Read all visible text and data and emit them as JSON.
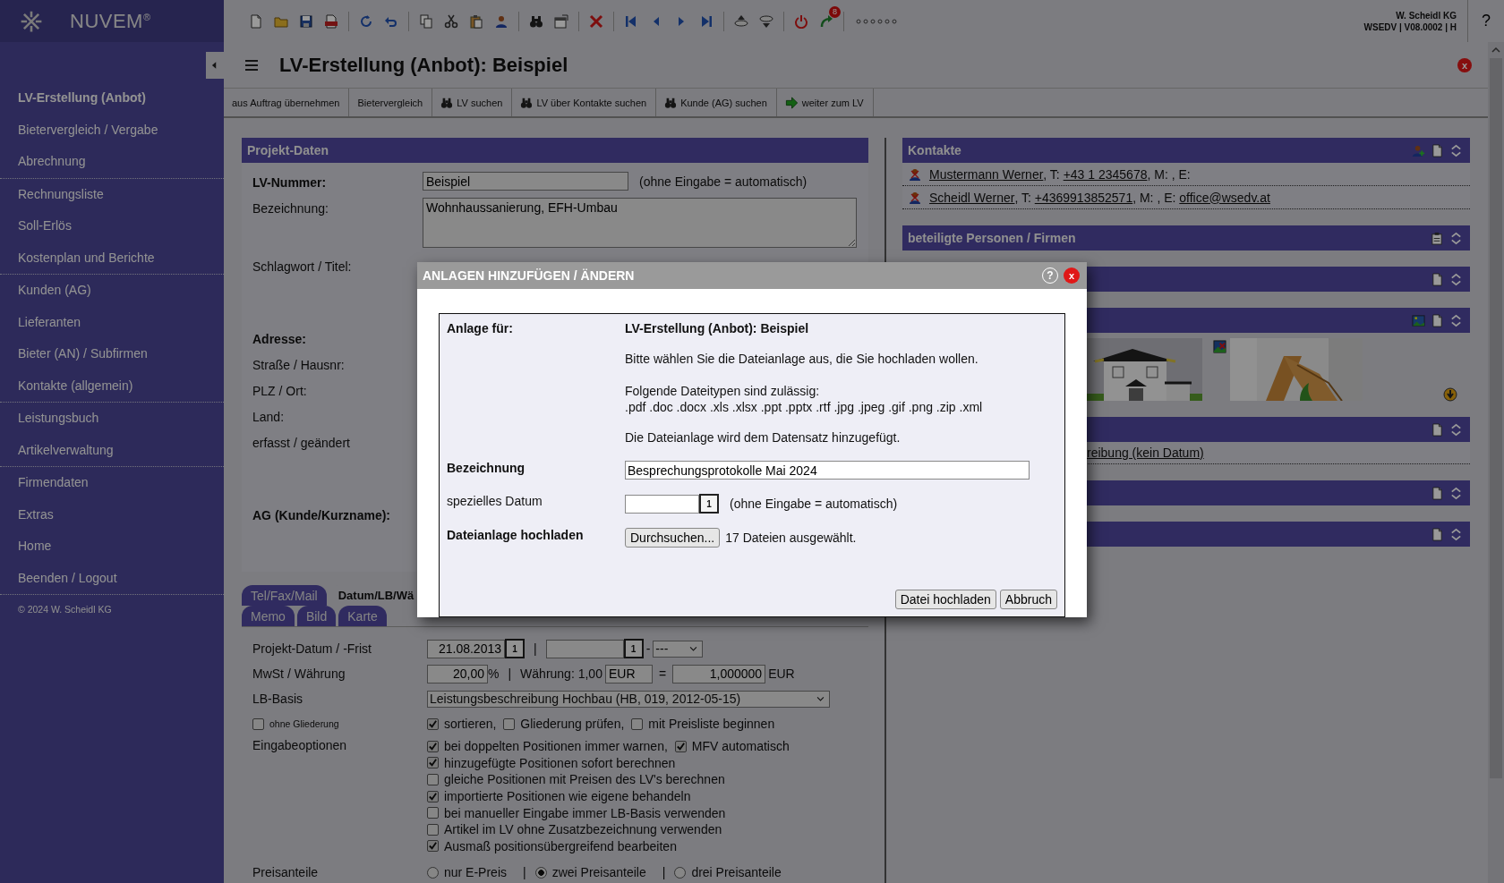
{
  "header": {
    "logo": "NUVEM$^{®}$",
    "badge": "8",
    "company": "W. Scheidl KG",
    "version": "WSEDV | V08.0002 | H",
    "help": "?"
  },
  "sidebar": {
    "groups": [
      [
        {
          "label": "LV-Erstellung (Anbot)",
          "selected": true
        },
        {
          "label": "Bietervergleich / Vergabe",
          "selected": false
        },
        {
          "label": "Abrechnung",
          "selected": false
        }
      ],
      [
        {
          "label": "Rechnungsliste",
          "selected": false
        },
        {
          "label": "Soll-Erlös",
          "selected": false
        },
        {
          "label": "Kostenplan und Berichte",
          "selected": false
        }
      ],
      [
        {
          "label": "Kunden (AG)",
          "selected": false
        },
        {
          "label": "Lieferanten",
          "selected": false
        },
        {
          "label": "Bieter (AN) / Subfirmen",
          "selected": false
        },
        {
          "label": "Kontakte (allgemein)",
          "selected": false
        }
      ],
      [
        {
          "label": "Leistungsbuch",
          "selected": false
        },
        {
          "label": "Artikelverwaltung",
          "selected": false
        }
      ],
      [
        {
          "label": "Firmendaten",
          "selected": false
        },
        {
          "label": "Extras",
          "selected": false
        },
        {
          "label": "Home",
          "selected": false
        },
        {
          "label": "Beenden / Logout",
          "selected": false
        }
      ]
    ],
    "copyright": "© 2024 W. Scheidl KG"
  },
  "page": {
    "title": "LV-Erstellung (Anbot): Beispiel",
    "close": "x"
  },
  "actions": [
    {
      "label": "aus Auftrag übernehmen",
      "kind": "plain"
    },
    {
      "label": "Bietervergleich",
      "kind": "plain"
    },
    {
      "label": "LV suchen",
      "kind": "search"
    },
    {
      "label": "LV über Kontakte suchen",
      "kind": "search"
    },
    {
      "label": "Kunde (AG) suchen",
      "kind": "search"
    },
    {
      "label": "weiter zum LV",
      "kind": "forward"
    }
  ],
  "project": {
    "title": "Projekt-Daten",
    "fields": [
      {
        "label": "LV-Nummer:",
        "bold": true,
        "kind": "input",
        "value": "Beispiel",
        "note": "(ohne Eingabe = automatisch)"
      },
      {
        "label": "Bezeichnung:",
        "bold": false,
        "kind": "textarea",
        "value": "Wohnhaussanierung, EFH-Umbau"
      },
      {
        "label": "Schlagwort / Titel:",
        "bold": false,
        "kind": "tall"
      },
      {
        "label": "Adresse:",
        "bold": true,
        "kind": "heading"
      },
      {
        "label": "Straße / Hausnr:",
        "bold": false,
        "kind": "label"
      },
      {
        "label": "PLZ / Ort:",
        "bold": false,
        "kind": "label"
      },
      {
        "label": "Land:",
        "bold": false,
        "kind": "label"
      },
      {
        "label": "erfasst / geändert",
        "bold": false,
        "kind": "tall"
      },
      {
        "label": "AG (Kunde/Kurzname):",
        "bold": true,
        "kind": "heading"
      }
    ]
  },
  "tabs": [
    [
      {
        "label": "Tel/Fax/Mail",
        "selected": false
      },
      {
        "label": "Datum/LB/Wä",
        "selected": true
      }
    ],
    [
      {
        "label": "Memo",
        "selected": false
      },
      {
        "label": "Bild",
        "selected": false
      },
      {
        "label": "Karte",
        "selected": false
      }
    ]
  ],
  "options": {
    "date": {
      "label": "Projekt-Datum / -Frist",
      "date": "21.08.2013",
      "calendar": "1",
      "separator": "|",
      "calendar_2": "1",
      "dash": "-",
      "select": "---"
    },
    "vat": {
      "label": "MwSt / Währung",
      "rate": "20,00",
      "percent": "%",
      "separator": "|",
      "rate_label": "Währung: 1,00",
      "currency": "EUR",
      "equals": "=",
      "factor": "1,000000",
      "base_currency": "EUR"
    },
    "basis": {
      "label": "LB-Basis",
      "value": "Leistungsbeschreibung Hochbau (HB, 019, 2012-05-15)"
    },
    "structure": {
      "option": {
        "label": "ohne Gliederung",
        "checked": false
      },
      "checks": [
        {
          "label": "sortieren,",
          "checked": true
        },
        {
          "label": "Gliederung prüfen,",
          "checked": false
        },
        {
          "label": "mit Preisliste beginnen",
          "checked": false
        }
      ]
    },
    "input": {
      "label": "Eingabeoptionen",
      "lines": [
        [
          {
            "label": "bei doppelten Positionen immer warnen,",
            "checked": true
          },
          {
            "label": "MFV automatisch",
            "checked": true
          }
        ],
        [
          {
            "label": "hinzugefügte Positionen sofort berechnen",
            "checked": true
          }
        ],
        [
          {
            "label": "gleiche Positionen mit Preisen des LV's berechnen",
            "checked": false
          }
        ],
        [
          {
            "label": "importierte Positionen wie eigene behandeln",
            "checked": true
          }
        ],
        [
          {
            "label": "bei manueller Eingabe immer LB-Basis verwenden",
            "checked": false
          }
        ],
        [
          {
            "label": "Artikel im LV ohne Zusatzbezeichnung verwenden",
            "checked": false
          }
        ],
        [
          {
            "label": "Ausmaß positionsübergreifend bearbeiten",
            "checked": true
          }
        ]
      ]
    },
    "price": {
      "label": "Preisanteile",
      "radios": [
        {
          "label": "nur E-Preis",
          "selected": false,
          "separator": "|"
        },
        {
          "label": "zwei Preisanteile",
          "selected": true,
          "separator": "|"
        },
        {
          "label": "drei Preisanteile",
          "selected": false
        }
      ]
    }
  },
  "panels": [
    {
      "title": "Kontakte",
      "kind": "contacts",
      "contacts": [
        {
          "segments": [
            {
              "text": "Mustermann Werner ",
              "link": true
            },
            {
              "text": ", T: ",
              "link": false
            },
            {
              "text": "+43 1 2345678",
              "link": true
            },
            {
              "text": ", M: , E:",
              "link": false
            }
          ]
        },
        {
          "segments": [
            {
              "text": "Scheidl Werner",
              "link": true
            },
            {
              "text": ", T: ",
              "link": false
            },
            {
              "text": "+4369913852571",
              "link": true
            },
            {
              "text": ", M: , E: ",
              "link": false
            },
            {
              "text": "office@wsedv.at",
              "link": true
            }
          ]
        }
      ]
    },
    {
      "title": "beteiligte Personen / Firmen",
      "kind": "persons"
    },
    {
      "kind": "empty"
    },
    {
      "kind": "images"
    },
    {
      "kind": "links",
      "links": [
        "reibung (kein Datum)"
      ]
    },
    {
      "kind": "empty"
    },
    {
      "kind": "empty"
    }
  ],
  "dialog": {
    "title": "ANLAGEN HINZUFÜGEN / ÄNDERN",
    "help": "?",
    "close": "x",
    "for_label": "Anlage für:",
    "for_value": "LV-Erstellung (Anbot): Beispiel",
    "intro": "Bitte wählen Sie die Dateianlage aus, die Sie hochladen wollen.",
    "types_heading": "Folgende Dateitypen sind zulässig:",
    "types": ".pdf .doc .docx .xls .xlsx .ppt .pptx .rtf .jpg .jpeg .gif .png .zip .xml",
    "note": "Die Dateianlage wird dem Datensatz hinzugefügt.",
    "name_label": "Bezeichnung",
    "name_value": "Besprechungsprotokolle Mai 2024",
    "date_label": "spezielles Datum",
    "calendar": "1",
    "date_note": "(ohne Eingabe = automatisch)",
    "upload_label": "Dateianlage hochladen",
    "browse": "Durchsuchen...",
    "selected_files": "17 Dateien ausgewählt.",
    "buttons": [
      "Datei hochladen",
      "Abbruch"
    ]
  }
}
